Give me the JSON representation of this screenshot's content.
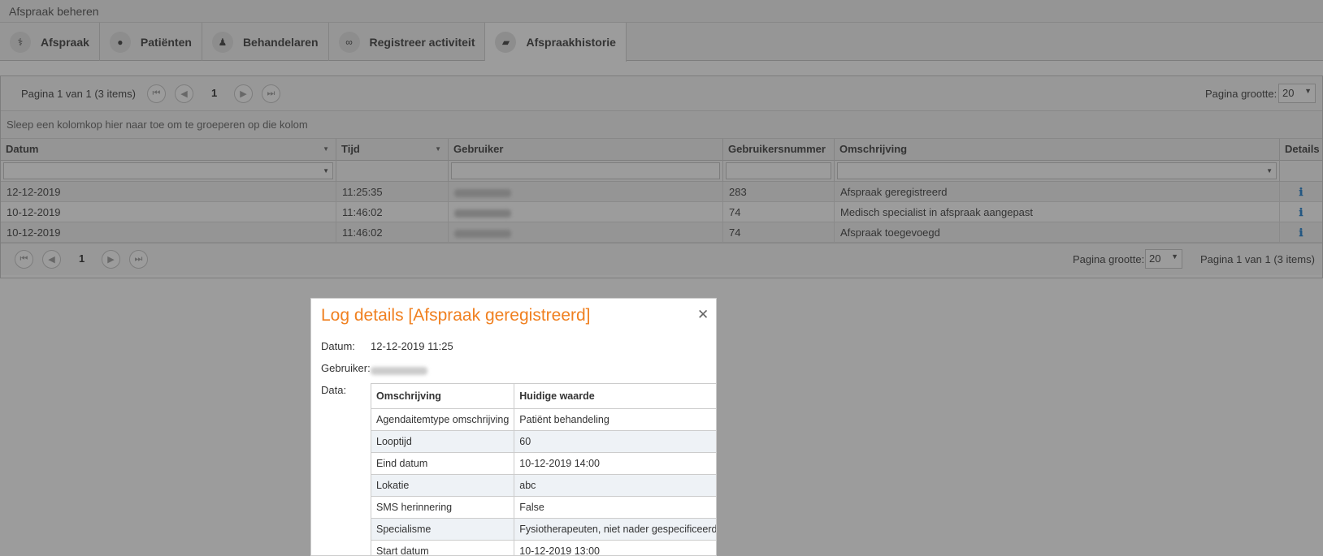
{
  "window": {
    "title": "Afspraak beheren"
  },
  "tabs": [
    {
      "label": "Afspraak",
      "icon": "stethoscope-icon",
      "glyph": "⚕"
    },
    {
      "label": "Patiënten",
      "icon": "user-icon",
      "glyph": "●"
    },
    {
      "label": "Behandelaren",
      "icon": "doctor-icon",
      "glyph": "♟"
    },
    {
      "label": "Registreer activiteit",
      "icon": "link-icon",
      "glyph": "∞"
    },
    {
      "label": "Afspraakhistorie",
      "icon": "book-icon",
      "glyph": "▰"
    }
  ],
  "pager_top": {
    "info": "Pagina 1 van 1 (3 items)",
    "page": "1",
    "size_label": "Pagina grootte:",
    "size_value": "20"
  },
  "group_hint": "Sleep een kolomkop hier naar toe om te groeperen op die kolom",
  "columns": [
    "Datum",
    "Tijd",
    "Gebruiker",
    "Gebruikersnummer",
    "Omschrijving",
    "Details"
  ],
  "rows": [
    {
      "datum": "12-12-2019",
      "tijd": "11:25:35",
      "nummer": "283",
      "omschrijving": "Afspraak geregistreerd"
    },
    {
      "datum": "10-12-2019",
      "tijd": "11:46:02",
      "nummer": "74",
      "omschrijving": "Medisch specialist in afspraak aangepast"
    },
    {
      "datum": "10-12-2019",
      "tijd": "11:46:02",
      "nummer": "74",
      "omschrijving": "Afspraak toegevoegd"
    }
  ],
  "details_glyph": "ℹ",
  "pager_bottom": {
    "page": "1",
    "size_label": "Pagina grootte:",
    "size_value": "20",
    "info": "Pagina 1 van 1 (3 items)"
  },
  "dialog": {
    "title": "Log details [Afspraak geregistreerd]",
    "close": "✕",
    "datum_label": "Datum:",
    "datum_value": "12-12-2019 11:25",
    "gebruiker_label": "Gebruiker:",
    "data_label": "Data:",
    "table_headers": [
      "Omschrijving",
      "Huidige waarde"
    ],
    "table_rows": [
      [
        "Agendaitemtype omschrijving",
        "Patiënt behandeling"
      ],
      [
        "Looptijd",
        "60"
      ],
      [
        "Eind datum",
        "10-12-2019 14:00"
      ],
      [
        "Lokatie",
        "abc"
      ],
      [
        "SMS herinnering",
        "False"
      ],
      [
        "Specialisme",
        "Fysiotherapeuten, niet nader gespecificeerd"
      ],
      [
        "Start datum",
        "10-12-2019 13:00"
      ]
    ]
  }
}
